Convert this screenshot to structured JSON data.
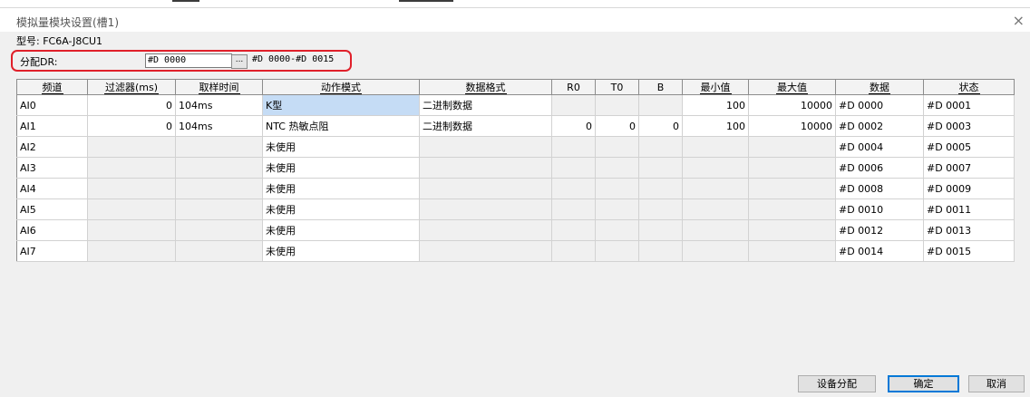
{
  "dialog": {
    "title": "模拟量模块设置(槽1)",
    "close_glyph": "×",
    "model_text": "型号: FC6A-J8CU1"
  },
  "allocation": {
    "label": "分配DR:",
    "value": "#D 0000",
    "browse_label": "...",
    "range": "#D 0000-#D 0015"
  },
  "table": {
    "headers": [
      "频道",
      "过滤器(ms)",
      "取样时间",
      "动作模式",
      "数据格式",
      "R0",
      "T0",
      "B",
      "最小值",
      "最大值",
      "数据",
      "状态"
    ],
    "rows": [
      [
        "AI0",
        "0",
        "104ms",
        "K型",
        "二进制数据",
        "",
        "",
        "",
        "100",
        "10000",
        "#D 0000",
        "#D 0001"
      ],
      [
        "AI1",
        "0",
        "104ms",
        "NTC 热敏点阻",
        "二进制数据",
        "0",
        "0",
        "0",
        "100",
        "10000",
        "#D 0002",
        "#D 0003"
      ],
      [
        "AI2",
        "",
        "",
        "未使用",
        "",
        "",
        "",
        "",
        "",
        "",
        "#D 0004",
        "#D 0005"
      ],
      [
        "AI3",
        "",
        "",
        "未使用",
        "",
        "",
        "",
        "",
        "",
        "",
        "#D 0006",
        "#D 0007"
      ],
      [
        "AI4",
        "",
        "",
        "未使用",
        "",
        "",
        "",
        "",
        "",
        "",
        "#D 0008",
        "#D 0009"
      ],
      [
        "AI5",
        "",
        "",
        "未使用",
        "",
        "",
        "",
        "",
        "",
        "",
        "#D 0010",
        "#D 0011"
      ],
      [
        "AI6",
        "",
        "",
        "未使用",
        "",
        "",
        "",
        "",
        "",
        "",
        "#D 0012",
        "#D 0013"
      ],
      [
        "AI7",
        "",
        "",
        "未使用",
        "",
        "",
        "",
        "",
        "",
        "",
        "#D 0014",
        "#D 0015"
      ]
    ]
  },
  "buttons": {
    "device_alloc": "设备分配",
    "ok": "确定",
    "cancel": "取消"
  },
  "colors": {
    "highlight_border": "#e0202a",
    "selected_cell": "#c5dcf5",
    "primary_border": "#0078d7"
  }
}
